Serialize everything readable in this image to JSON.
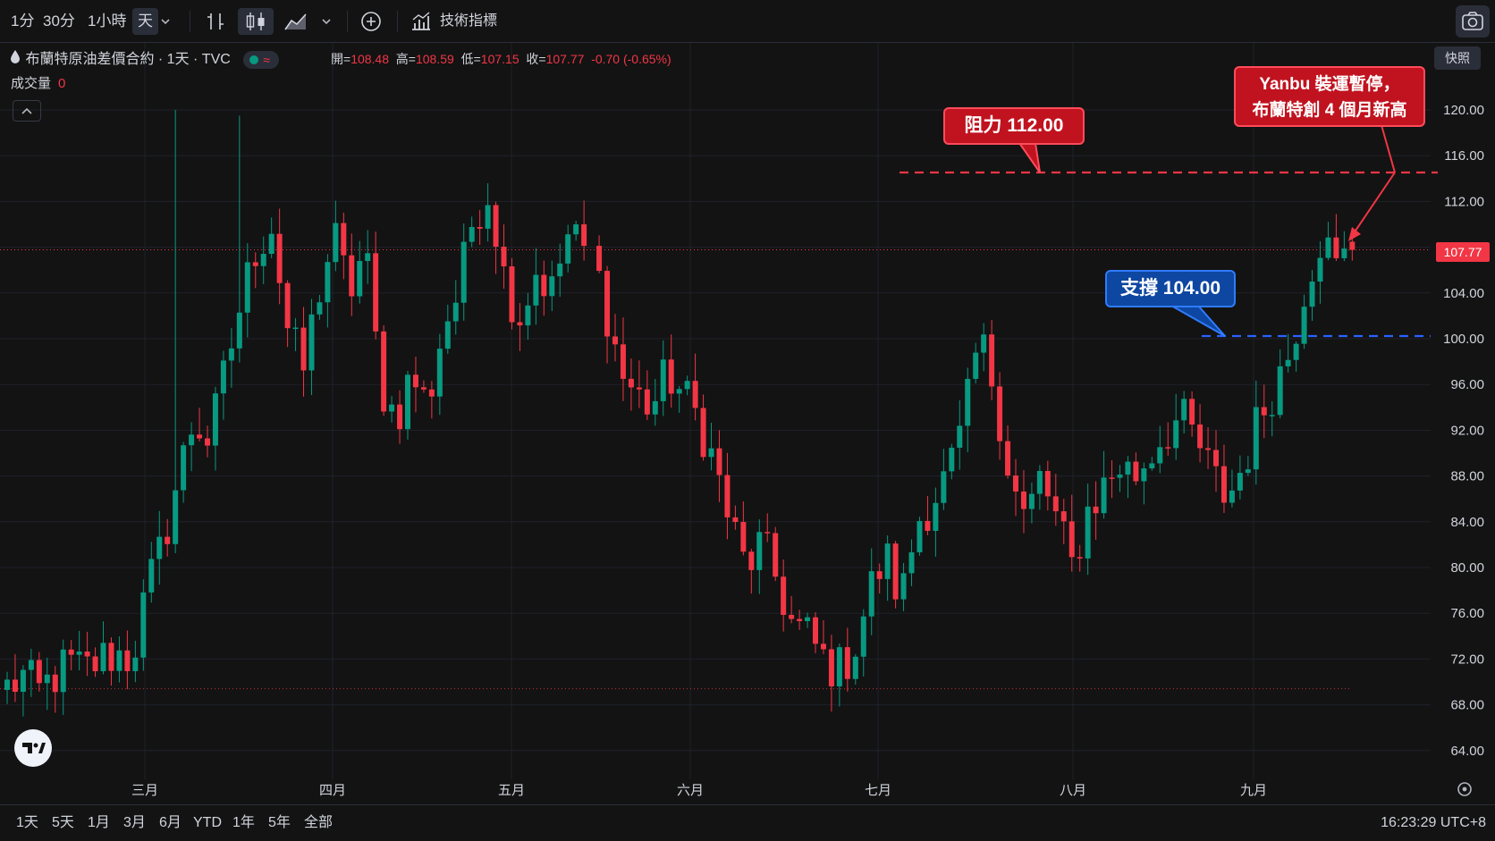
{
  "toolbar": {
    "intervals": [
      "1分",
      "30分",
      "1小時",
      "天"
    ],
    "active_interval": "天",
    "indicators_label": "技術指標"
  },
  "legend": {
    "title": "布蘭特原油差價合約 · 1天 · TVC",
    "ohlc": [
      {
        "k": "開=",
        "v": "108.48"
      },
      {
        "k": "高=",
        "v": "108.59"
      },
      {
        "k": "低=",
        "v": "107.15"
      },
      {
        "k": "收=",
        "v": "107.77"
      }
    ],
    "change": "-0.70 (-0.65%)",
    "volume_label": "成交量",
    "volume_value": "0"
  },
  "snapshot_label": "快照",
  "annotations": {
    "resistance_label": "阻力 112.00",
    "support_label": "支撐 104.00",
    "news_line1": "Yanbu 裝運暫停，",
    "news_line2": "布蘭特創 4 個月新高"
  },
  "bottom": {
    "ranges": [
      "1天",
      "5天",
      "1月",
      "3月",
      "6月",
      "YTD",
      "1年",
      "5年",
      "全部"
    ],
    "clock": "16:23:29 UTC+8"
  },
  "colors": {
    "up": "#089981",
    "down": "#f23645",
    "resistance": "#f23645",
    "support": "#2962ff",
    "background": "#131313"
  },
  "chart_data": {
    "type": "candlestick",
    "symbol": "布蘭特原油差價合約",
    "interval": "1天",
    "last_price": "107.77",
    "y_ticks": [
      64,
      68,
      72,
      76,
      80,
      84,
      88,
      92,
      96,
      100,
      104,
      108,
      112,
      116,
      120
    ],
    "y_tick_labels": [
      "64.00",
      "68.00",
      "72.00",
      "76.00",
      "80.00",
      "84.00",
      "88.00",
      "92.00",
      "96.00",
      "100.00",
      "104.00",
      "112.00",
      "116.00",
      "120.00"
    ],
    "months": [
      "三月",
      "四月",
      "五月",
      "六月",
      "七月",
      "八月",
      "九月"
    ],
    "resistance": 112.0,
    "support": 104.0,
    "waypoints": [
      69.5,
      70.5,
      69.0,
      70.5,
      71.5,
      71.0,
      72.0,
      72.5,
      72.0,
      78.0,
      82.0,
      88.0,
      93.0,
      91.0,
      97.0,
      103.0,
      108.0,
      110.0,
      101.0,
      97.0,
      104.0,
      109.0,
      104.0,
      108.0,
      96.0,
      93.0,
      97.0,
      94.0,
      101.0,
      104.0,
      111.0,
      113.0,
      105.0,
      102.0,
      106.0,
      104.0,
      109.0,
      108.0,
      103.0,
      97.0,
      95.0,
      94.0,
      97.0,
      95.0,
      93.0,
      89.0,
      84.0,
      80.0,
      82.0,
      79.0,
      75.0,
      74.0,
      72.0,
      71.0,
      73.0,
      78.0,
      81.0,
      77.0,
      84.0,
      86.0,
      88.0,
      92.0,
      100.0,
      96.0,
      88.0,
      84.0,
      88.0,
      84.0,
      80.0,
      85.0,
      87.0,
      89.0,
      88.0,
      90.0,
      92.0,
      93.0,
      91.0,
      88.0,
      86.0,
      89.0,
      93.0,
      96.0,
      99.0,
      105.0,
      109.0,
      106.0,
      108.0
    ]
  }
}
